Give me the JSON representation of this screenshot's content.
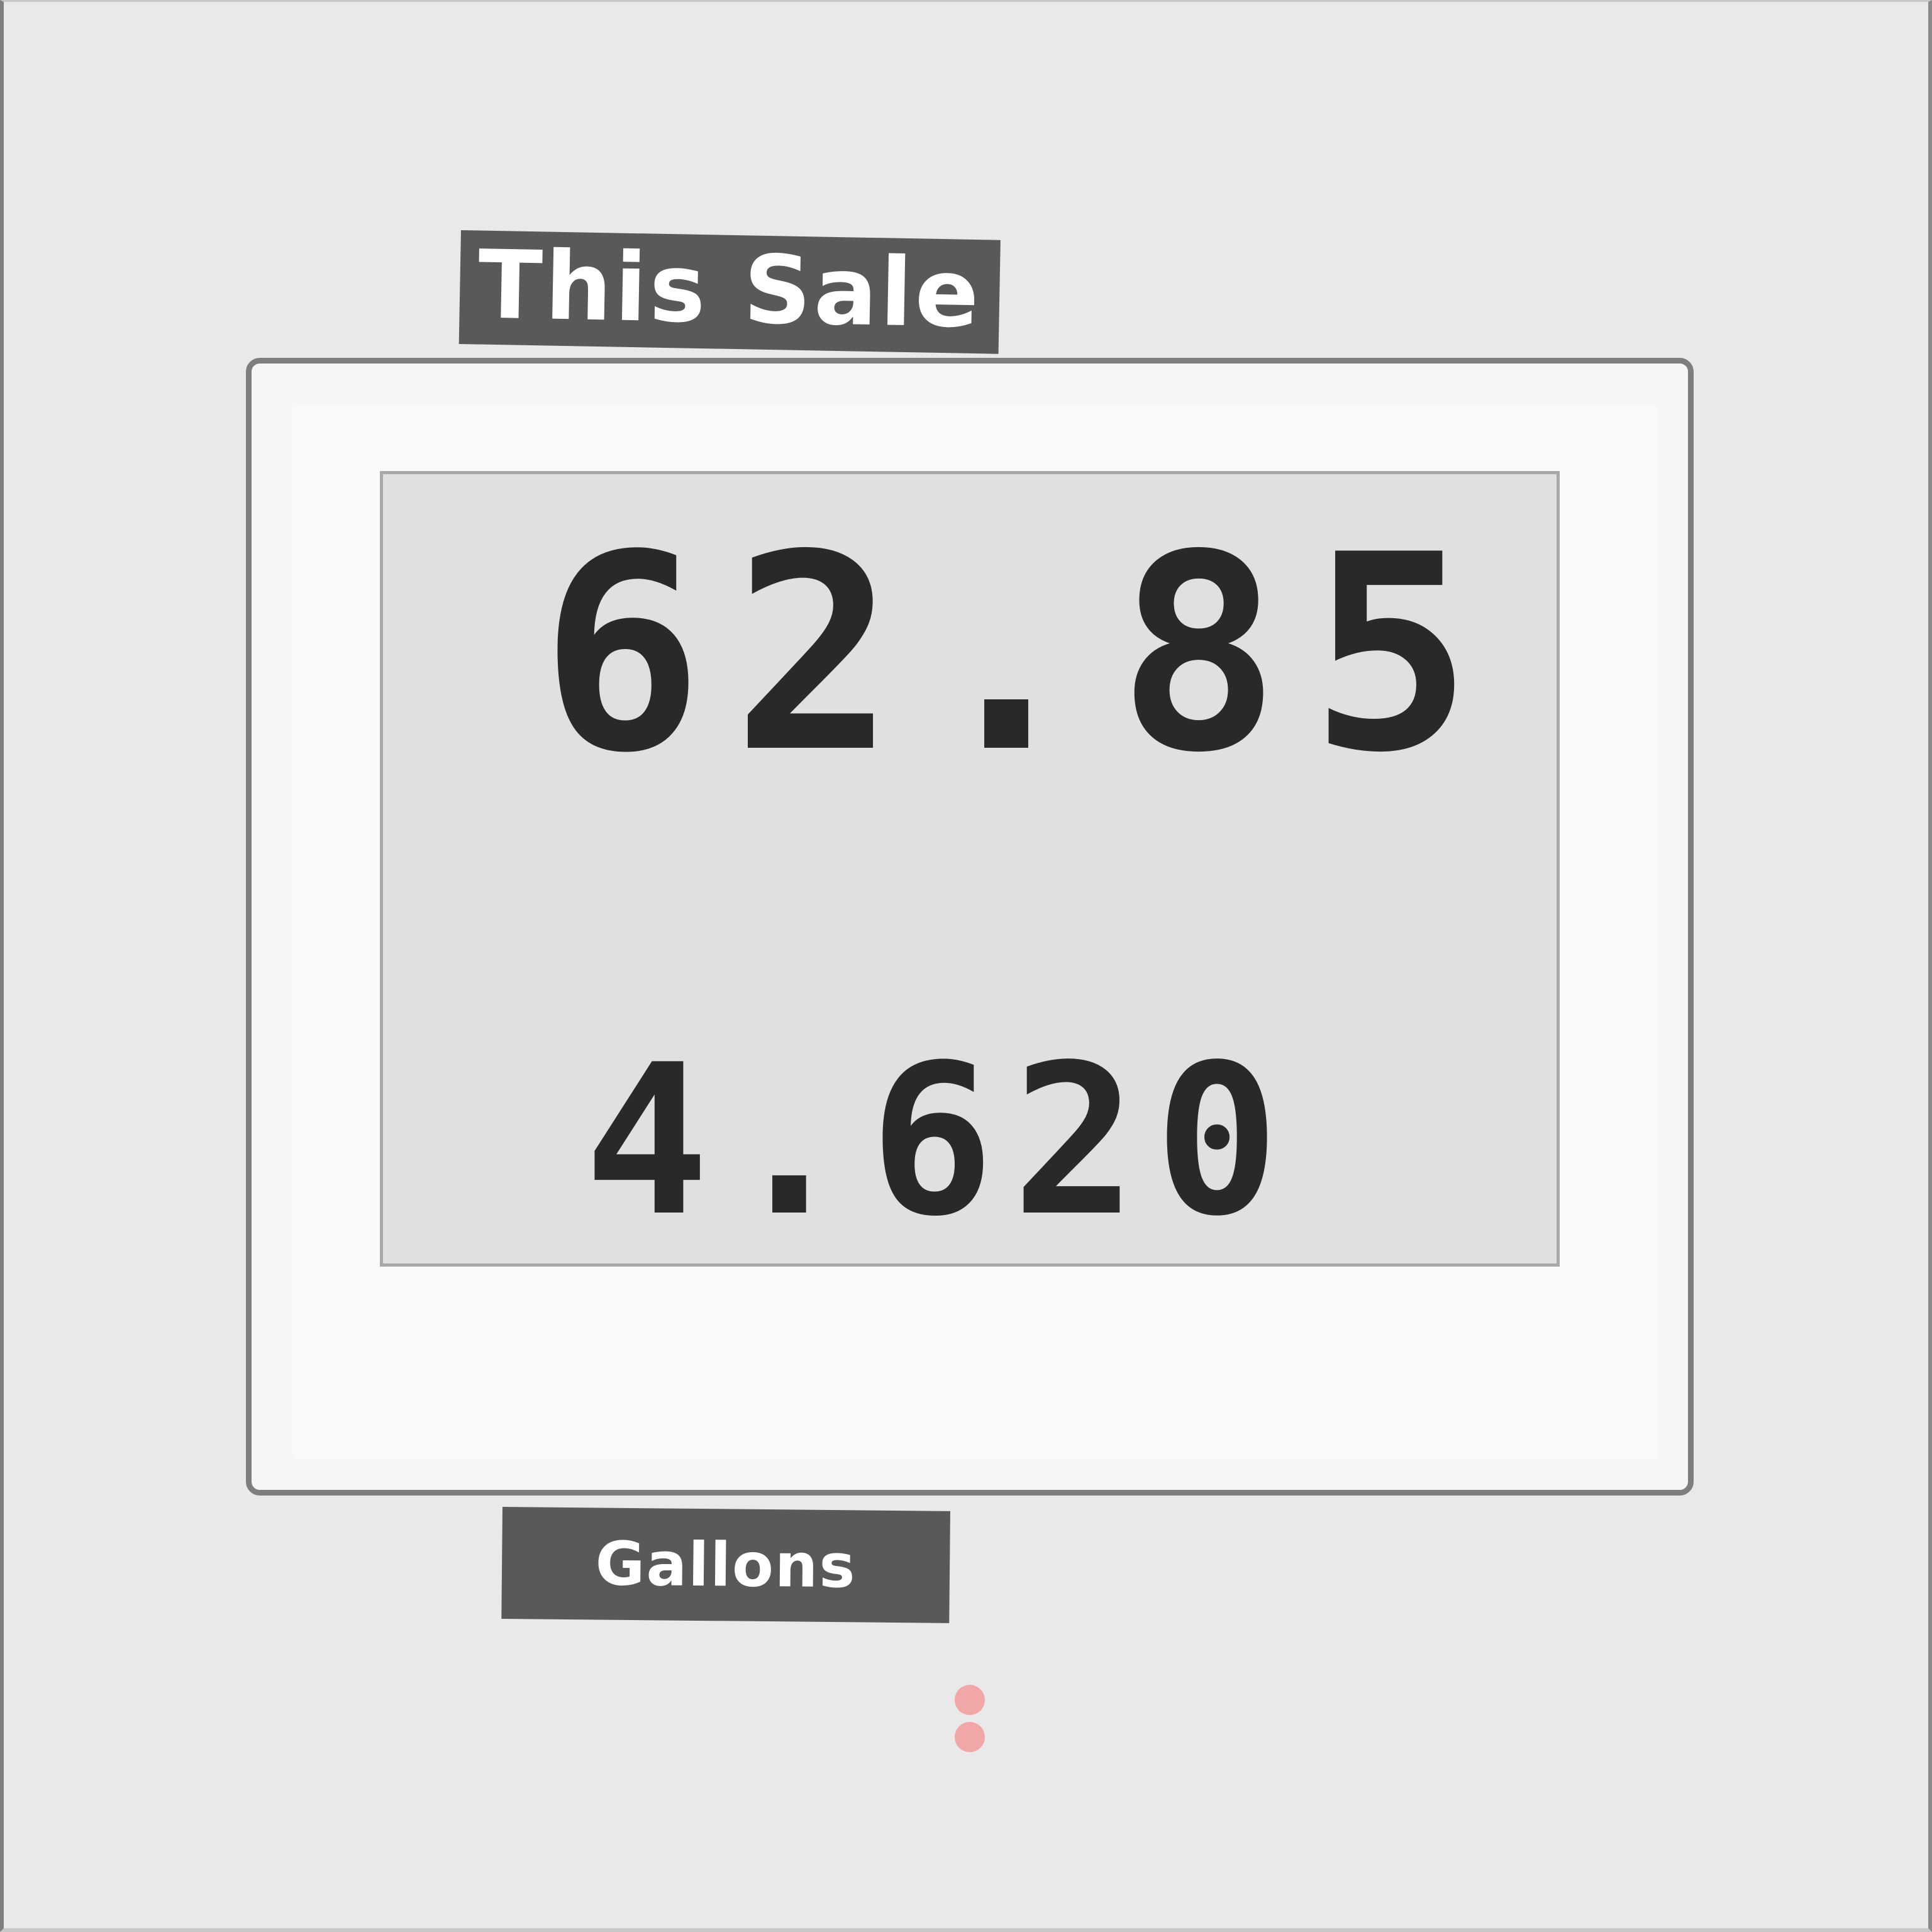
{
  "pump_display": {
    "sale_label": "This Sale",
    "sale_value": "62.85",
    "gallons_value": "4.620",
    "gallons_label": "Gallons"
  },
  "indicators": [
    {
      "name": "indicator-light-1",
      "color": "#f1a7a7"
    },
    {
      "name": "indicator-light-2",
      "color": "#f1a7a7"
    }
  ],
  "colors": {
    "label_plate": "#595959",
    "display_background": "#e0e0e0",
    "digits": "#292929",
    "panel_border": "#7e7e7e"
  }
}
